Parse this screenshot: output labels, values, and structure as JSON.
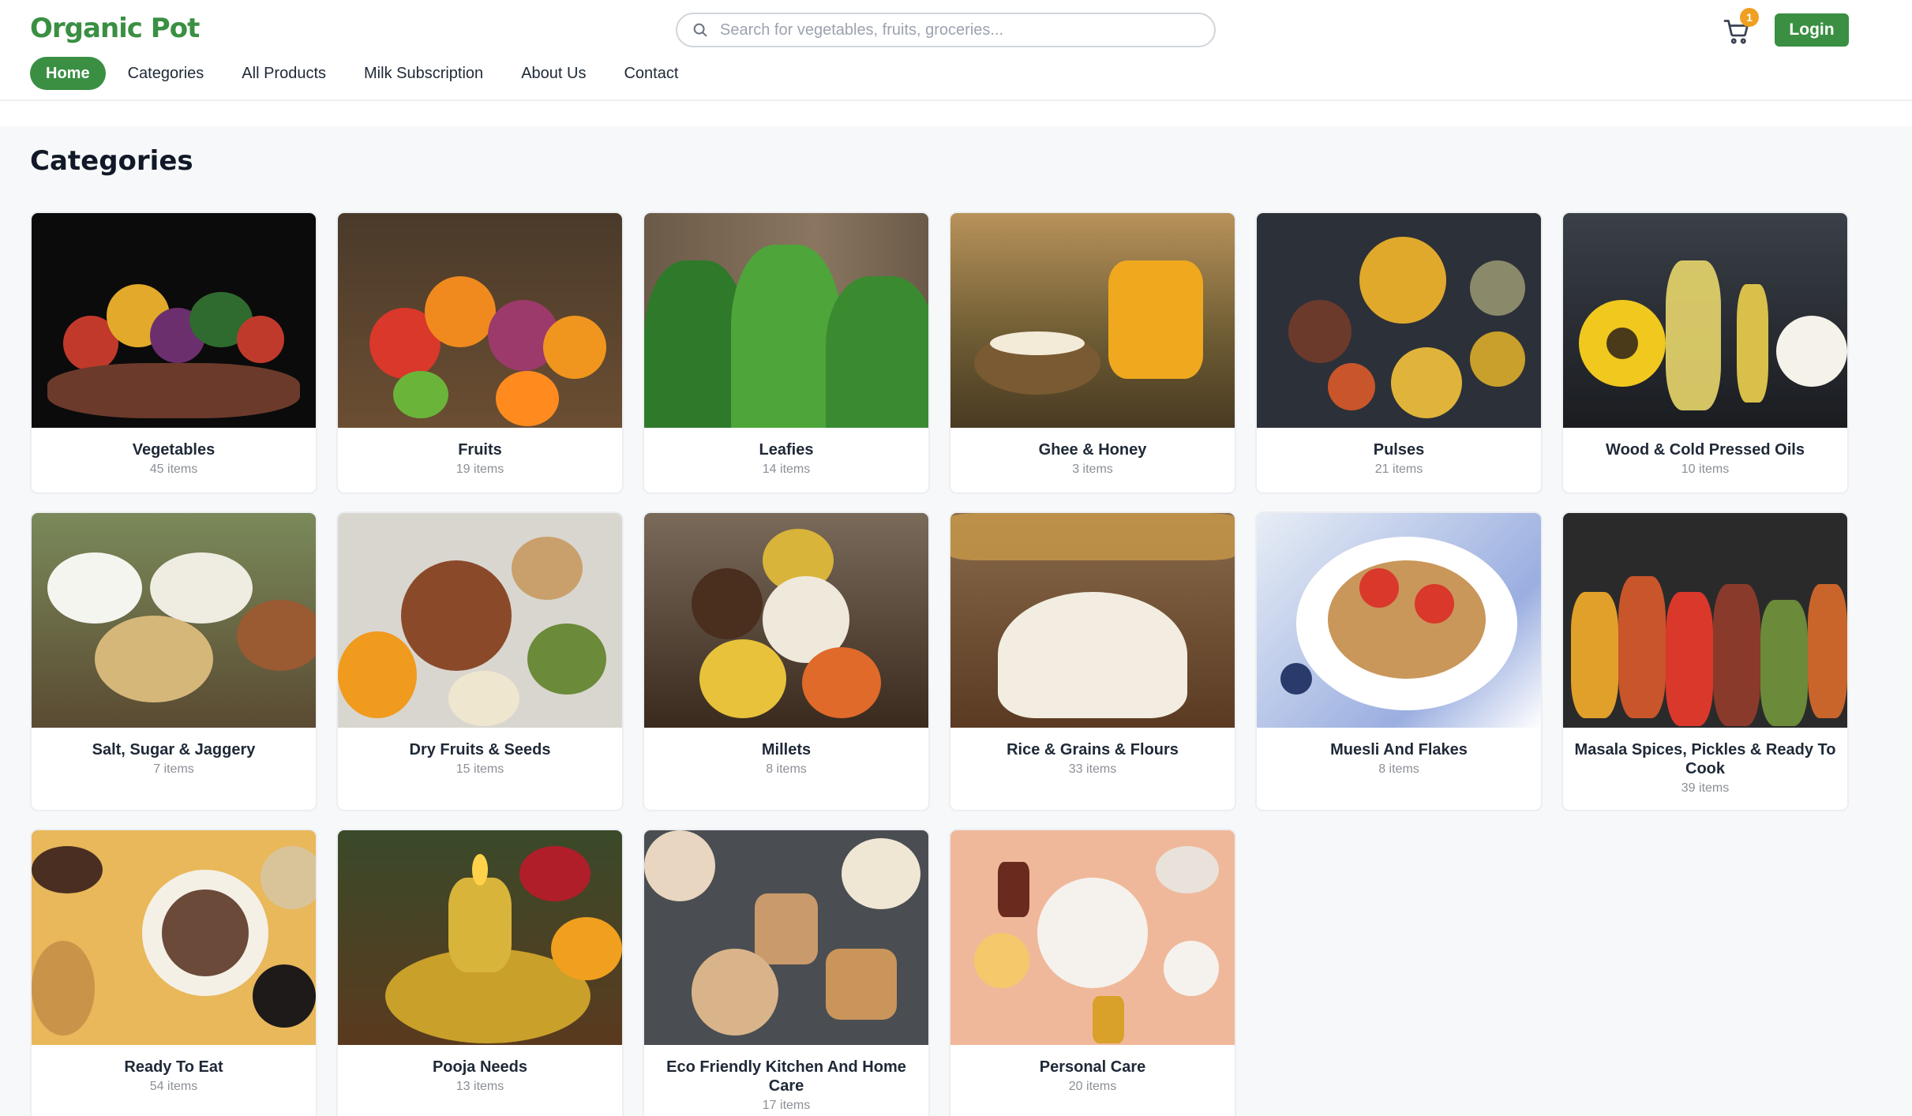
{
  "header": {
    "logo": "Organic Pot",
    "search_placeholder": "Search for vegetables, fruits, groceries...",
    "cart_count": "1",
    "login_label": "Login",
    "nav": [
      "Home",
      "Categories",
      "All Products",
      "Milk Subscription",
      "About Us",
      "Contact"
    ]
  },
  "main": {
    "title": "Categories",
    "categories": [
      {
        "name": "Vegetables",
        "count": "45 items"
      },
      {
        "name": "Fruits",
        "count": "19 items"
      },
      {
        "name": "Leafies",
        "count": "14 items"
      },
      {
        "name": "Ghee & Honey",
        "count": "3 items"
      },
      {
        "name": "Pulses",
        "count": "21 items"
      },
      {
        "name": "Wood & Cold Pressed Oils",
        "count": "10 items"
      },
      {
        "name": "Salt, Sugar & Jaggery",
        "count": "7 items"
      },
      {
        "name": "Dry Fruits & Seeds",
        "count": "15 items"
      },
      {
        "name": "Millets",
        "count": "8 items"
      },
      {
        "name": "Rice & Grains & Flours",
        "count": "33 items"
      },
      {
        "name": "Muesli And Flakes",
        "count": "8 items"
      },
      {
        "name": "Masala Spices, Pickles & Ready To Cook",
        "count": "39 items"
      },
      {
        "name": "Ready To Eat",
        "count": "54 items"
      },
      {
        "name": "Pooja Needs",
        "count": "13 items"
      },
      {
        "name": "Eco Friendly Kitchen And Home Care",
        "count": "17 items"
      },
      {
        "name": "Personal Care",
        "count": "20 items"
      }
    ]
  },
  "colors": {
    "brand": "#3a8f43",
    "badge": "#f0a020"
  },
  "icons": {
    "search": "search-icon",
    "cart": "cart-icon"
  }
}
